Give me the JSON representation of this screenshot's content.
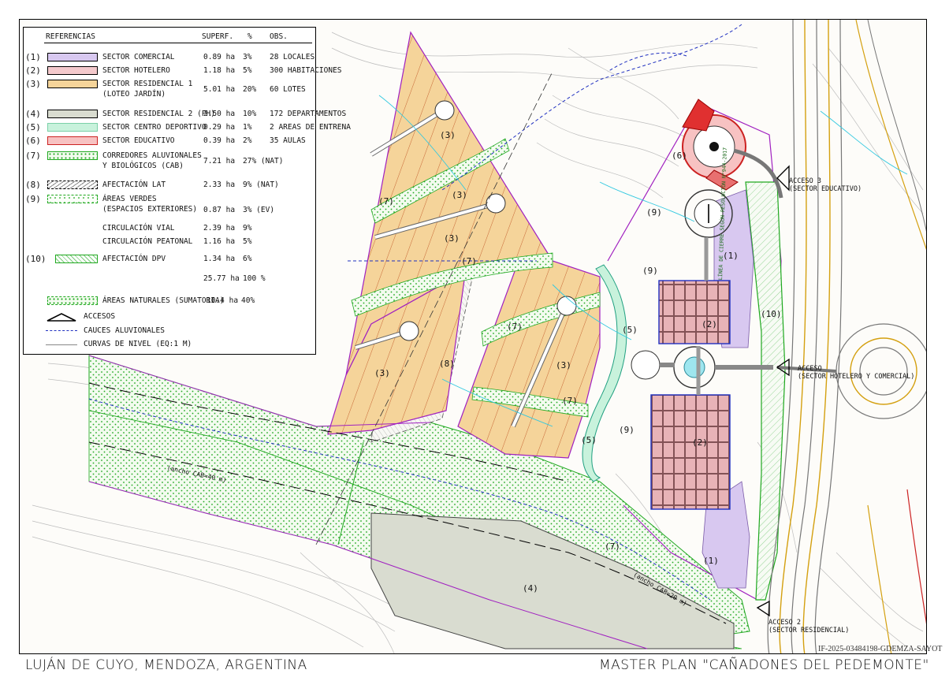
{
  "legend": {
    "headers": {
      "ref": "REFERENCIAS",
      "area": "SUPERF.",
      "pct": "%",
      "obs": "OBS."
    },
    "rows": [
      {
        "num": "(1)",
        "label": "SECTOR COMERCIAL",
        "area": "0.89 ha",
        "pct": "3%",
        "obs": "28 LOCALES",
        "color": "#d8c8f0"
      },
      {
        "num": "(2)",
        "label": "SECTOR HOTELERO",
        "area": "1.18 ha",
        "pct": "5%",
        "obs": "300 HABITACIONES",
        "color": "#f4c9cc"
      },
      {
        "num": "(3)",
        "label": "SECTOR RESIDENCIAL 1",
        "label2": "(LOTEO JARDÍN)",
        "area": "5.01 ha",
        "pct": "20%",
        "obs": "60 LOTES",
        "color": "#f5d49a"
      },
      {
        "num": "(4)",
        "label": "SECTOR RESIDENCIAL 2 (PH)",
        "area": "2.50 ha",
        "pct": "10%",
        "obs": "172 DEPARTAMENTOS",
        "color": "#d9dcd0"
      },
      {
        "num": "(5)",
        "label": "SECTOR CENTRO DEPORTIVO",
        "area": "0.29 ha",
        "pct": "1%",
        "obs": "2 AREAS DE ENTRENA",
        "color": "#c8f2dc"
      },
      {
        "num": "(6)",
        "label": "SECTOR EDUCATIVO",
        "area": "0.39 ha",
        "pct": "2%",
        "obs": "35 AULAS",
        "color": "#f7c2c2"
      },
      {
        "num": "(7)",
        "label": "CORREDORES ALUVIONALES",
        "label2": "Y BIOLÓGICOS (CAB)",
        "area": "7.21 ha",
        "pct": "27% (NAT)",
        "obs": "",
        "color": "#ffffff"
      },
      {
        "num": "(8)",
        "label": "AFECTACIÓN LAT",
        "area": "2.33 ha",
        "pct": "9% (NAT)",
        "obs": "",
        "color": "#ffffff"
      },
      {
        "num": "(9)",
        "label": "ÁREAS VERDES",
        "label2": "(ESPACIOS EXTERIORES)",
        "area": "0.87 ha",
        "pct": "3% (EV)",
        "obs": "",
        "color": "#ffffff"
      },
      {
        "num": "",
        "label": "CIRCULACIÓN VIAL",
        "area": "2.39 ha",
        "pct": "9%",
        "obs": "",
        "color": ""
      },
      {
        "num": "",
        "label": "CIRCULACIÓN PEATONAL",
        "area": "1.16 ha",
        "pct": "5%",
        "obs": "",
        "color": ""
      },
      {
        "num": "(10)",
        "label": "AFECTACIÓN DPV",
        "area": "1.34 ha",
        "pct": "6%",
        "obs": "",
        "color": "#ffffff"
      }
    ],
    "total": {
      "area": "25.77 ha",
      "pct": "100 %"
    },
    "natural": {
      "label": "ÁREAS NATURALES  (SUMATORIA)",
      "area": "10.4 ha",
      "pct": "40%"
    },
    "symbols": {
      "accesos": "ACCESOS",
      "cauces": "CAUCES ALUVIONALES",
      "curvas": "CURVAS DE NIVEL (EQ:1 M)"
    }
  },
  "map": {
    "labels": {
      "n1a": "(1)",
      "n1b": "(1)",
      "n2a": "(2)",
      "n2b": "(2)",
      "n3a": "(3)",
      "n3b": "(3)",
      "n3c": "(3)",
      "n3d": "(3)",
      "n3e": "(3)",
      "n4": "(4)",
      "n5a": "(5)",
      "n5b": "(5)",
      "n6": "(6)",
      "n7a": "(7)",
      "n7b": "(7)",
      "n7c": "(7)",
      "n7d": "(7)",
      "n7e": "(7)",
      "n8": "(8)",
      "n9a": "(9)",
      "n9b": "(9)",
      "n9c": "(9)",
      "n10": "(10)",
      "cab40": "(ancho CAB=40 m)",
      "cab20": "(ancho CAB=20 m)",
      "linea": "LÍNEA DE CIERRE SEGÚN RESOLUCIÓN N°944-2017"
    },
    "access": {
      "a3_title": "ACCESO 3",
      "a3_sub": "(SECTOR EDUCATIVO)",
      "a1_title": "ACCESO",
      "a1_sub": "(SECTOR HOTELERO Y COMERCIAL)",
      "a2_title": "ACCESO 2",
      "a2_sub": "(SECTOR RESIDENCIAL)"
    }
  },
  "footer": {
    "left": "LUJÁN DE CUYO, MENDOZA, ARGENTINA",
    "right": "MASTER PLAN  \"CAÑADONES DEL PEDEMONTE\"",
    "stamp": "IF-2025-03484198-GDEMZA-SAYOT"
  },
  "colors": {
    "comercial": "#d8c8f0",
    "hotelero": "#f4c9cc",
    "residencial1": "#f5d49a",
    "residencial2": "#d9dcd0",
    "deportivo": "#c8f2dc",
    "educativo": "#f7c2c2",
    "green": "#1fa81f",
    "purple": "#a020c0",
    "blue": "#2030c0"
  }
}
